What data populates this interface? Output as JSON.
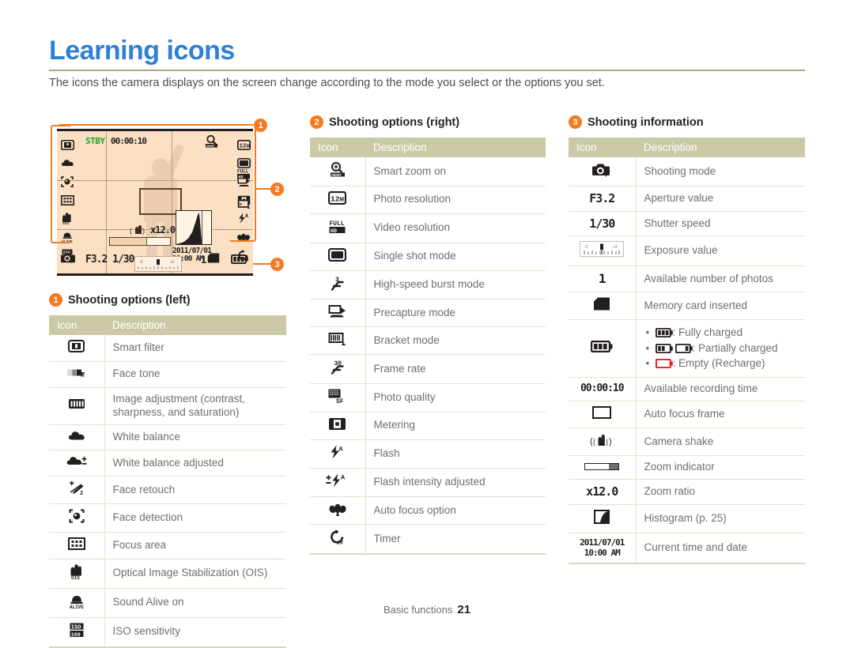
{
  "page": {
    "title": "Learning icons",
    "intro": "The icons the camera displays on the screen change according to the mode you select or the options you set.",
    "footer_label": "Basic functions",
    "page_number": "21",
    "accent_color": "#f47b20",
    "title_color": "#2f7fd6",
    "table_header_color": "#ccc9a6",
    "screen_color": "#fbe0c3"
  },
  "camera_screen": {
    "stby_label": "STBY",
    "recording_time": "00:00:10",
    "aperture": "F3.2",
    "shutter": "1/30",
    "zoom_ratio": "x12.0",
    "date": "2011/07/01",
    "time": "10:00 AM",
    "shots_left": "1",
    "markers": [
      {
        "number": "1",
        "target": "shooting options (left)"
      },
      {
        "number": "2",
        "target": "shooting options (right)"
      },
      {
        "number": "3",
        "target": "shooting information"
      }
    ]
  },
  "sections": {
    "left": {
      "badge": "1",
      "title": "Shooting options (left)",
      "columns": {
        "icon": "Icon",
        "description": "Description"
      },
      "rows": [
        {
          "icon": "smart-filter-icon",
          "description": "Smart filter"
        },
        {
          "icon": "face-tone-icon",
          "description": "Face tone"
        },
        {
          "icon": "image-adjustment-icon",
          "description": "Image adjustment (contrast, sharpness, and saturation)"
        },
        {
          "icon": "white-balance-icon",
          "description": "White balance"
        },
        {
          "icon": "white-balance-adjusted-icon",
          "description": "White balance adjusted"
        },
        {
          "icon": "face-retouch-icon",
          "description": "Face retouch"
        },
        {
          "icon": "face-detection-icon",
          "description": "Face detection"
        },
        {
          "icon": "focus-area-icon",
          "description": "Focus area"
        },
        {
          "icon": "ois-icon",
          "description": "Optical Image Stabilization (OIS)"
        },
        {
          "icon": "sound-alive-icon",
          "description": "Sound Alive on"
        },
        {
          "icon": "iso-icon",
          "description": "ISO sensitivity"
        }
      ]
    },
    "right": {
      "badge": "2",
      "title": "Shooting options (right)",
      "columns": {
        "icon": "Icon",
        "description": "Description"
      },
      "rows": [
        {
          "icon": "smart-zoom-icon",
          "description": "Smart zoom on"
        },
        {
          "icon": "photo-resolution-icon",
          "description": "Photo resolution"
        },
        {
          "icon": "video-resolution-icon",
          "description": "Video resolution"
        },
        {
          "icon": "single-shot-icon",
          "description": "Single shot mode"
        },
        {
          "icon": "high-speed-burst-icon",
          "description": "High-speed burst mode"
        },
        {
          "icon": "precapture-icon",
          "description": "Precapture mode"
        },
        {
          "icon": "bracket-icon",
          "description": "Bracket mode"
        },
        {
          "icon": "frame-rate-icon",
          "description": "Frame rate"
        },
        {
          "icon": "photo-quality-icon",
          "description": "Photo quality"
        },
        {
          "icon": "metering-icon",
          "description": "Metering"
        },
        {
          "icon": "flash-icon",
          "description": "Flash"
        },
        {
          "icon": "flash-intensity-icon",
          "description": "Flash intensity adjusted"
        },
        {
          "icon": "auto-focus-option-icon",
          "description": "Auto focus option"
        },
        {
          "icon": "timer-icon",
          "description": "Timer"
        }
      ]
    },
    "info": {
      "badge": "3",
      "title": "Shooting information",
      "columns": {
        "icon": "Icon",
        "description": "Description"
      },
      "rows": [
        {
          "icon": "shooting-mode-icon",
          "description": "Shooting mode"
        },
        {
          "icon": "aperture-value-icon",
          "icon_text": "F3.2",
          "description": "Aperture value"
        },
        {
          "icon": "shutter-speed-icon",
          "icon_text": "1/30",
          "description": "Shutter speed"
        },
        {
          "icon": "exposure-value-icon",
          "description": "Exposure value"
        },
        {
          "icon": "available-photos-icon",
          "icon_text": "1",
          "description": "Available number of photos"
        },
        {
          "icon": "memory-card-icon",
          "description": "Memory card inserted"
        },
        {
          "icon": "battery-icon",
          "description": "battery-list"
        },
        {
          "icon": "recording-time-icon",
          "icon_text": "00:00:10",
          "description": "Available recording time"
        },
        {
          "icon": "auto-focus-frame-icon",
          "description": "Auto focus frame"
        },
        {
          "icon": "camera-shake-icon",
          "description": "Camera shake"
        },
        {
          "icon": "zoom-indicator-icon",
          "description": "Zoom indicator"
        },
        {
          "icon": "zoom-ratio-icon",
          "icon_text": "x12.0",
          "description": "Zoom ratio"
        },
        {
          "icon": "histogram-icon",
          "description": "Histogram (p. 25)"
        },
        {
          "icon": "current-time-date-icon",
          "icon_text": "2011/07/01 10:00 AM",
          "description": "Current time and date"
        }
      ],
      "battery_states": [
        ": Fully charged",
        ": Partially charged",
        ": Empty (Recharge)"
      ]
    }
  }
}
